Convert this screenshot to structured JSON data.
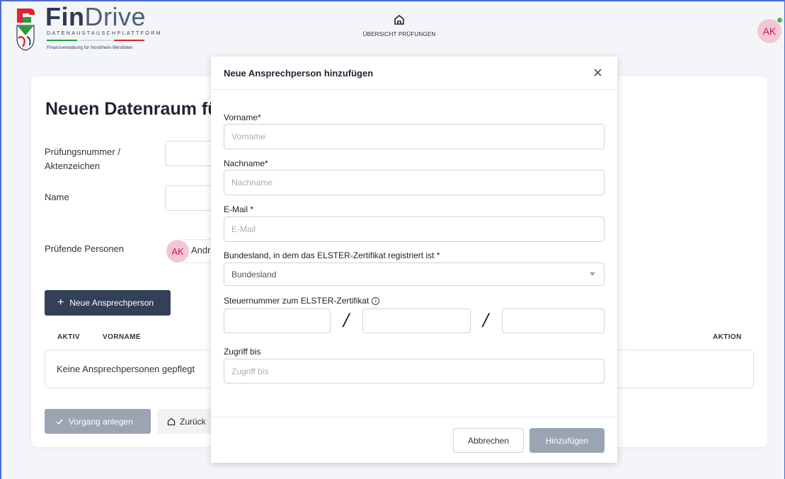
{
  "header": {
    "brand_fin": "Fin",
    "brand_drive": "Drive",
    "brand_sub": "DATENAUSTAUSCHPLATTFORM",
    "brand_region": "Finanzverwaltung für Nordrhein-Westfalen",
    "nav_label": "ÜBERSICHT PRÜFUNGEN",
    "user_initials": "AK",
    "colors": {
      "stripe_green": "#2e9b3a",
      "stripe_white": "#d7d7d7",
      "stripe_red": "#e2232e",
      "logo_red": "#e2232e",
      "logo_green": "#2e9b3a"
    }
  },
  "page": {
    "title": "Neuen Datenraum fü",
    "label_pruefnummer": "Prüfungsnummer /",
    "label_aktenzeichen": "Aktenzeichen",
    "label_name": "Name",
    "label_pruefende": "Prüfende Personen",
    "chip_initials": "AK",
    "chip_name": "Andr",
    "add_contact_button": "Neue Ansprechperson",
    "table_headers": {
      "active": "AKTIV",
      "firstname": "VORNAME",
      "action": "AKTION"
    },
    "empty_text": "Keine Ansprechpersonen gepflegt",
    "create_button": "Vorgang anlegen",
    "back_button": "Zurück"
  },
  "modal": {
    "title": "Neue Ansprechperson hinzufügen",
    "fields": {
      "firstname_label": "Vorname*",
      "firstname_placeholder": "Vorname",
      "lastname_label": "Nachname*",
      "lastname_placeholder": "Nachname",
      "email_label": "E-Mail *",
      "email_placeholder": "E-Mail",
      "state_label": "Bundesland, in dem das ELSTER-Zertifikat registriert ist *",
      "state_value": "Bundesland",
      "tax_label": "Steuernummer zum ELSTER-Zertifikat",
      "tax_separator": "/",
      "access_label": "Zugriff bis",
      "access_placeholder": "Zugriff bis"
    },
    "cancel_button": "Abbrechen",
    "add_button": "Hinzufügen"
  },
  "icons": {
    "logo": "nrw-coat-of-arms-icon",
    "nav": "home-icon",
    "close": "close-icon",
    "plus": "plus-icon",
    "check": "check-icon",
    "info": "info-icon",
    "caret": "chevron-down-icon"
  },
  "accent": {
    "dark_button": "#334057",
    "disabled_button": "#9aa4b2",
    "avatar_bg": "#f4c6d3",
    "avatar_text": "#c2185b",
    "online_dot": "#4caf50"
  }
}
